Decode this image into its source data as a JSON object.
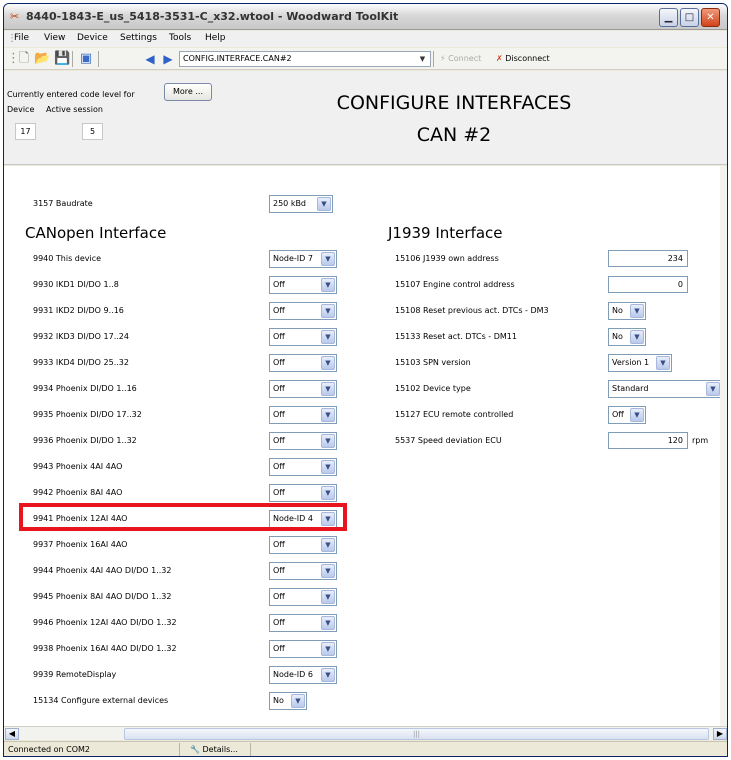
{
  "window": {
    "title": "8440-1843-E_us_5418-3531-C_x32.wtool - Woodward ToolKit",
    "controls": [
      "minimize",
      "maximize",
      "close"
    ]
  },
  "menu": [
    "File",
    "View",
    "Device",
    "Settings",
    "Tools",
    "Help"
  ],
  "toolbar": {
    "address": "CONFIG.INTERFACE.CAN#2",
    "connect_label": "Connect",
    "disconnect_label": "Disconnect"
  },
  "header": {
    "code_level_label": "Currently entered code level for",
    "more_button": "More ...",
    "device_label": "Device",
    "session_label": "Active session",
    "device_value": "17",
    "session_value": "5",
    "title_line1": "CONFIGURE INTERFACES",
    "title_line2": "CAN #2"
  },
  "baudrate": {
    "label": "3157 Baudrate",
    "value": "250 kBd"
  },
  "canopen": {
    "heading": "CANopen Interface",
    "rows": [
      {
        "label": "9940 This device",
        "value": "Node-ID 7"
      },
      {
        "label": "9930 IKD1 DI/DO 1..8",
        "value": "Off"
      },
      {
        "label": "9931 IKD2 DI/DO 9..16",
        "value": "Off"
      },
      {
        "label": "9932 IKD3 DI/DO 17..24",
        "value": "Off"
      },
      {
        "label": "9933 IKD4 DI/DO 25..32",
        "value": "Off"
      },
      {
        "label": "9934 Phoenix DI/DO 1..16",
        "value": "Off"
      },
      {
        "label": "9935 Phoenix DI/DO 17..32",
        "value": "Off"
      },
      {
        "label": "9936 Phoenix DI/DO 1..32",
        "value": "Off"
      },
      {
        "label": "9943 Phoenix 4AI 4AO",
        "value": "Off"
      },
      {
        "label": "9942 Phoenix 8AI 4AO",
        "value": "Off"
      },
      {
        "label": "9941 Phoenix 12AI 4AO",
        "value": "Node-ID 4"
      },
      {
        "label": "9937 Phoenix 16AI 4AO",
        "value": "Off"
      },
      {
        "label": "9944 Phoenix 4AI 4AO DI/DO 1..32",
        "value": "Off"
      },
      {
        "label": "9945 Phoenix 8AI 4AO DI/DO 1..32",
        "value": "Off"
      },
      {
        "label": "9946 Phoenix 12AI 4AO DI/DO 1..32",
        "value": "Off"
      },
      {
        "label": "9938 Phoenix 16AI 4AO DI/DO 1..32",
        "value": "Off"
      },
      {
        "label": "9939 RemoteDisplay",
        "value": "Node-ID 6"
      },
      {
        "label": "15134 Configure external devices",
        "value": "No"
      }
    ]
  },
  "j1939": {
    "heading": "J1939 Interface",
    "own_address": {
      "label": "15106 J1939 own address",
      "value": "234"
    },
    "engine_address": {
      "label": "15107 Engine control address",
      "value": "0"
    },
    "dm3": {
      "label": "15108 Reset previous act. DTCs - DM3",
      "value": "No"
    },
    "dm11": {
      "label": "15133 Reset act. DTCs - DM11",
      "value": "No"
    },
    "spn": {
      "label": "15103 SPN version",
      "value": "Version 1"
    },
    "device_type": {
      "label": "15102 Device type",
      "value": "Standard"
    },
    "ecu_remote": {
      "label": "15127 ECU remote controlled",
      "value": "Off"
    },
    "speed_dev": {
      "label": "5537 Speed deviation ECU",
      "value": "120",
      "unit": "rpm"
    }
  },
  "status": {
    "connection": "Connected on COM2",
    "details_button": "Details..."
  },
  "colors": {
    "highlight": "#e8141e",
    "window_bg": "#ece9d8"
  },
  "icons": [
    "wrench-app-icon",
    "new-file-icon",
    "open-folder-icon",
    "save-icon",
    "image-icon",
    "back-icon",
    "forward-icon",
    "connect-icon",
    "disconnect-icon",
    "details-icon"
  ]
}
